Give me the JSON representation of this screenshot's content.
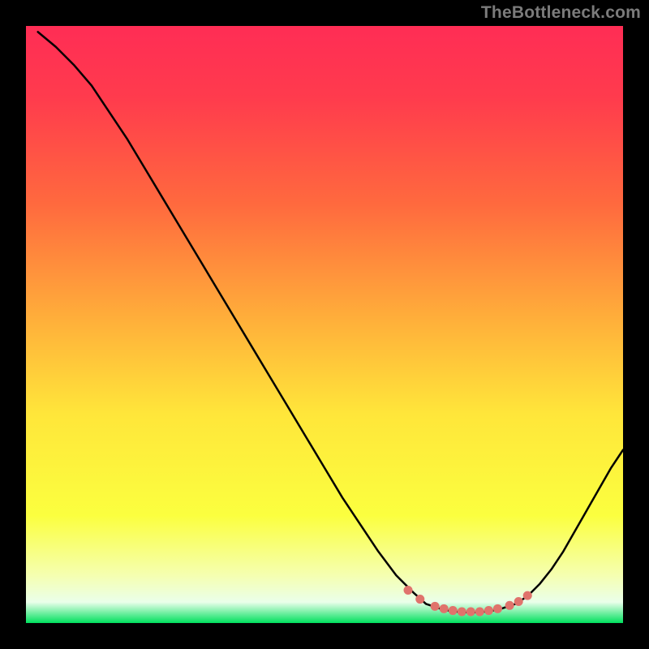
{
  "watermark": "TheBottleneck.com",
  "gradient_stops": [
    {
      "offset": 0.0,
      "color": "#ff2d55"
    },
    {
      "offset": 0.12,
      "color": "#ff3b4d"
    },
    {
      "offset": 0.3,
      "color": "#ff6a3e"
    },
    {
      "offset": 0.5,
      "color": "#ffb23a"
    },
    {
      "offset": 0.65,
      "color": "#ffe63a"
    },
    {
      "offset": 0.82,
      "color": "#fbff3f"
    },
    {
      "offset": 0.92,
      "color": "#f5ffb0"
    },
    {
      "offset": 0.965,
      "color": "#eaffea"
    },
    {
      "offset": 1.0,
      "color": "#00e05e"
    }
  ],
  "chart_data": {
    "type": "line",
    "title": "",
    "xlabel": "",
    "ylabel": "",
    "xlim": [
      0,
      100
    ],
    "ylim": [
      0,
      100
    ],
    "legend": false,
    "grid": false,
    "curve": [
      {
        "x": 2,
        "y": 99
      },
      {
        "x": 5,
        "y": 96.5
      },
      {
        "x": 8,
        "y": 93.5
      },
      {
        "x": 11,
        "y": 90
      },
      {
        "x": 14,
        "y": 85.5
      },
      {
        "x": 17,
        "y": 81
      },
      {
        "x": 20,
        "y": 76
      },
      {
        "x": 23,
        "y": 71
      },
      {
        "x": 26,
        "y": 66
      },
      {
        "x": 29,
        "y": 61
      },
      {
        "x": 32,
        "y": 56
      },
      {
        "x": 35,
        "y": 51
      },
      {
        "x": 38,
        "y": 46
      },
      {
        "x": 41,
        "y": 41
      },
      {
        "x": 44,
        "y": 36
      },
      {
        "x": 47,
        "y": 31
      },
      {
        "x": 50,
        "y": 26
      },
      {
        "x": 53,
        "y": 21
      },
      {
        "x": 56,
        "y": 16.5
      },
      {
        "x": 59,
        "y": 12
      },
      {
        "x": 62,
        "y": 8
      },
      {
        "x": 65,
        "y": 5
      },
      {
        "x": 67,
        "y": 3.2
      },
      {
        "x": 70,
        "y": 2.2
      },
      {
        "x": 73,
        "y": 1.8
      },
      {
        "x": 76,
        "y": 1.8
      },
      {
        "x": 79,
        "y": 2.2
      },
      {
        "x": 82,
        "y": 3.2
      },
      {
        "x": 84,
        "y": 4.5
      },
      {
        "x": 86,
        "y": 6.5
      },
      {
        "x": 88,
        "y": 9
      },
      {
        "x": 90,
        "y": 12
      },
      {
        "x": 92,
        "y": 15.5
      },
      {
        "x": 94,
        "y": 19
      },
      {
        "x": 96,
        "y": 22.5
      },
      {
        "x": 98,
        "y": 26
      },
      {
        "x": 100,
        "y": 29
      }
    ],
    "markers": [
      {
        "x": 64,
        "y": 5.5
      },
      {
        "x": 66,
        "y": 4.0
      },
      {
        "x": 68.5,
        "y": 2.8
      },
      {
        "x": 70,
        "y": 2.4
      },
      {
        "x": 71.5,
        "y": 2.1
      },
      {
        "x": 73,
        "y": 1.9
      },
      {
        "x": 74.5,
        "y": 1.9
      },
      {
        "x": 76,
        "y": 1.9
      },
      {
        "x": 77.5,
        "y": 2.1
      },
      {
        "x": 79,
        "y": 2.4
      },
      {
        "x": 81,
        "y": 2.95
      },
      {
        "x": 82.5,
        "y": 3.6
      },
      {
        "x": 84,
        "y": 4.6
      }
    ]
  }
}
